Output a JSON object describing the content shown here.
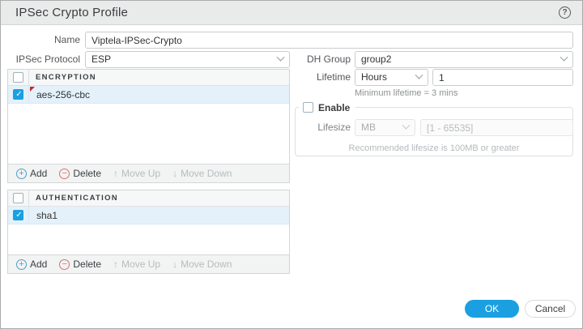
{
  "dialog": {
    "title": "IPSec Crypto Profile"
  },
  "form": {
    "name": {
      "label": "Name",
      "value": "Viptela-IPSec-Crypto"
    },
    "ipsec_protocol": {
      "label": "IPSec Protocol",
      "value": "ESP"
    },
    "dh_group": {
      "label": "DH Group",
      "value": "group2"
    },
    "lifetime": {
      "label": "Lifetime",
      "unit": "Hours",
      "value": "1",
      "note": "Minimum lifetime = 3 mins"
    },
    "enable": {
      "label": "Enable"
    },
    "lifesize": {
      "label": "Lifesize",
      "unit": "MB",
      "placeholder": "[1 - 65535]",
      "note": "Recommended lifesize is 100MB or greater"
    }
  },
  "encryption": {
    "title": "ENCRYPTION",
    "rows": [
      {
        "value": "aes-256-cbc"
      }
    ],
    "actions": {
      "add": "Add",
      "delete": "Delete",
      "move_up": "Move Up",
      "move_down": "Move Down"
    }
  },
  "authentication": {
    "title": "AUTHENTICATION",
    "rows": [
      {
        "value": "sha1"
      }
    ],
    "actions": {
      "add": "Add",
      "delete": "Delete",
      "move_up": "Move Up",
      "move_down": "Move Down"
    }
  },
  "footer": {
    "ok": "OK",
    "cancel": "Cancel"
  },
  "colors": {
    "accent_blue": "#1AA0E0",
    "selected_row": "#E4F1FA",
    "delete_red": "#D97070",
    "modified_flag": "#C02C2C"
  }
}
